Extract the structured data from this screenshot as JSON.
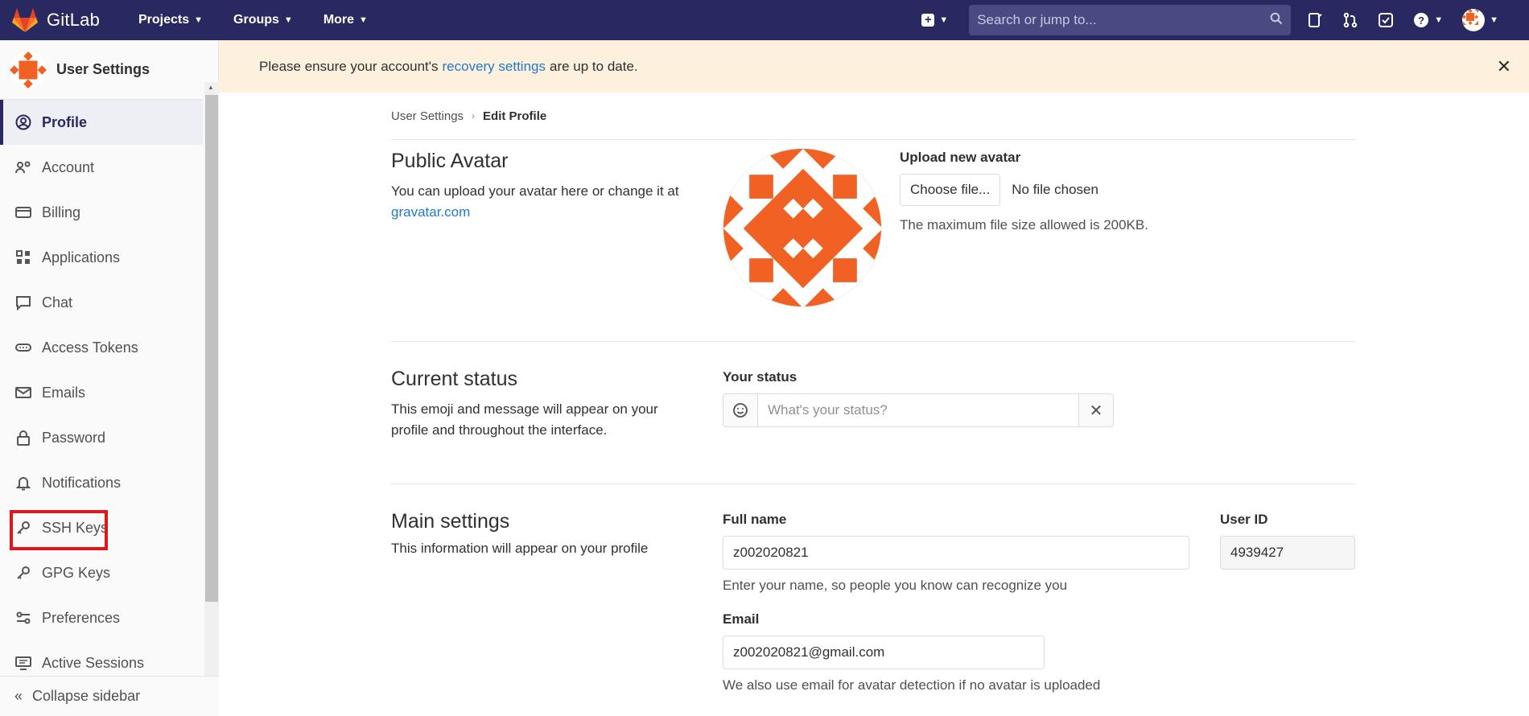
{
  "topbar": {
    "brand": "GitLab",
    "nav": [
      "Projects",
      "Groups",
      "More"
    ],
    "search_placeholder": "Search or jump to..."
  },
  "sidebar": {
    "title": "User Settings",
    "items": [
      {
        "label": "Profile",
        "icon": "user-circle-icon"
      },
      {
        "label": "Account",
        "icon": "account-icon"
      },
      {
        "label": "Billing",
        "icon": "credit-card-icon"
      },
      {
        "label": "Applications",
        "icon": "applications-icon"
      },
      {
        "label": "Chat",
        "icon": "chat-icon"
      },
      {
        "label": "Access Tokens",
        "icon": "token-icon"
      },
      {
        "label": "Emails",
        "icon": "mail-icon"
      },
      {
        "label": "Password",
        "icon": "lock-icon"
      },
      {
        "label": "Notifications",
        "icon": "bell-icon"
      },
      {
        "label": "SSH Keys",
        "icon": "key-icon"
      },
      {
        "label": "GPG Keys",
        "icon": "key-icon"
      },
      {
        "label": "Preferences",
        "icon": "preferences-icon"
      },
      {
        "label": "Active Sessions",
        "icon": "monitor-icon"
      }
    ],
    "collapse_label": "Collapse sidebar"
  },
  "alert": {
    "prefix": "Please ensure your account's",
    "link": "recovery settings",
    "suffix": "are up to date."
  },
  "breadcrumb": {
    "parent": "User Settings",
    "current": "Edit Profile"
  },
  "avatar_section": {
    "title": "Public Avatar",
    "desc": "You can upload your avatar here or change it at",
    "link": "gravatar.com",
    "upload_label": "Upload new avatar",
    "choose_btn": "Choose file...",
    "no_file": "No file chosen",
    "help": "The maximum file size allowed is 200KB."
  },
  "status_section": {
    "title": "Current status",
    "desc": "This emoji and message will appear on your profile and throughout the interface.",
    "label": "Your status",
    "placeholder": "What's your status?"
  },
  "main_section": {
    "title": "Main settings",
    "desc": "This information will appear on your profile",
    "fullname_label": "Full name",
    "fullname_value": "z002020821",
    "fullname_help": "Enter your name, so people you know can recognize you",
    "userid_label": "User ID",
    "userid_value": "4939427",
    "email_label": "Email",
    "email_value": "z002020821@gmail.com",
    "email_help": "We also use email for avatar detection if no avatar is uploaded"
  },
  "colors": {
    "navbar": "#292961",
    "accent_orange": "#f06123",
    "link": "#1f78d1",
    "alert_bg": "#fdf1dd",
    "highlight_red": "#e0161f"
  }
}
